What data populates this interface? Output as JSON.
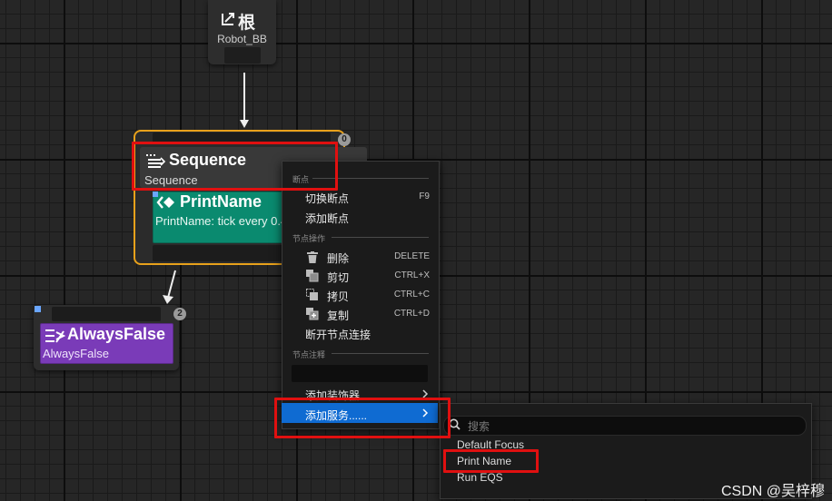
{
  "root_node": {
    "title": "根",
    "subtitle": "Robot_BB"
  },
  "sequence_node": {
    "title": "Sequence",
    "subtitle": "Sequence",
    "badge": "0"
  },
  "print_node": {
    "title": "PrintName",
    "subtitle": "PrintName: tick every 0.4"
  },
  "always_false_node": {
    "title": "AlwaysFalse",
    "subtitle": "AlwaysFalse",
    "badge": "2"
  },
  "context_menu": {
    "section_breakpoints": "断点",
    "toggle_breakpoint": {
      "label": "切换断点",
      "shortcut": "F9"
    },
    "add_breakpoint": {
      "label": "添加断点"
    },
    "section_node_actions": "节点操作",
    "delete": {
      "label": "删除",
      "shortcut": "DELETE"
    },
    "cut": {
      "label": "剪切",
      "shortcut": "CTRL+X"
    },
    "copy": {
      "label": "拷贝",
      "shortcut": "CTRL+C"
    },
    "duplicate": {
      "label": "复制",
      "shortcut": "CTRL+D"
    },
    "break_links": {
      "label": "断开节点连接"
    },
    "section_comment": "节点注释",
    "comment_value": "",
    "add_decorator": {
      "label": "添加装饰器"
    },
    "add_service": {
      "label": "添加服务......"
    }
  },
  "service_submenu": {
    "search_placeholder": "搜索",
    "items": [
      "Default Focus",
      "Print Name",
      "Run EQS"
    ]
  },
  "watermark": "CSDN @吴梓穆",
  "colors": {
    "selection_border": "#e8a11b",
    "task_green": "#0a8a6f",
    "decorator_purple": "#7a3bb8",
    "menu_highlight": "#0f6bd2",
    "annotation_red": "#e01010"
  }
}
